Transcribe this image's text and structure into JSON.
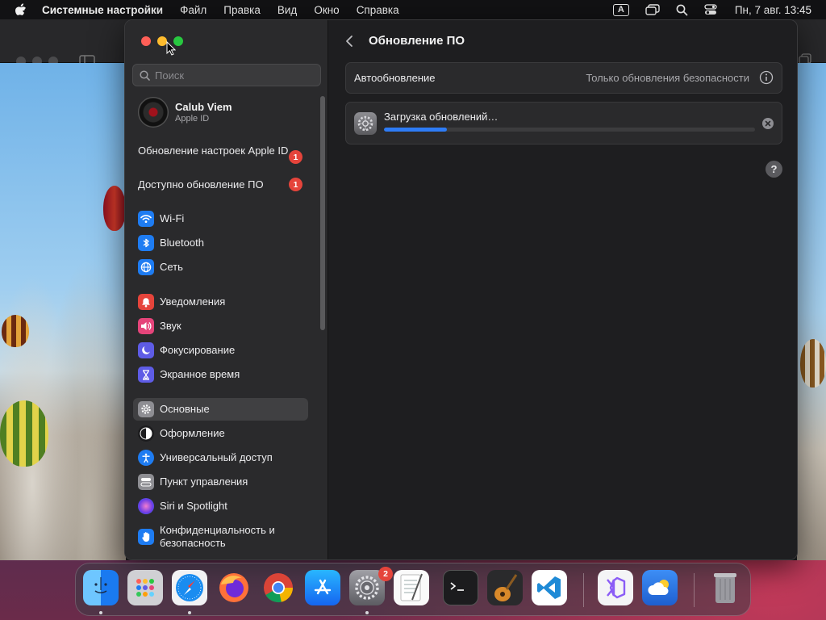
{
  "menubar": {
    "app_name": "Системные настройки",
    "items": [
      "Файл",
      "Правка",
      "Вид",
      "Окно",
      "Справка"
    ],
    "input_source": "A",
    "clock": "Пн, 7 авг.  13:45"
  },
  "sidebar": {
    "search_placeholder": "Поиск",
    "account": {
      "name": "Calub Viem",
      "subtitle": "Apple ID"
    },
    "notices": [
      {
        "label": "Обновление настроек Apple ID",
        "badge": "1"
      },
      {
        "label": "Доступно обновление ПО",
        "badge": "1"
      }
    ],
    "items": [
      {
        "label": "Wi-Fi",
        "icon": "wifi-icon",
        "color": "#1e7cf2"
      },
      {
        "label": "Bluetooth",
        "icon": "bluetooth-icon",
        "color": "#1e7cf2"
      },
      {
        "label": "Сеть",
        "icon": "globe-icon",
        "color": "#1e7cf2"
      },
      {
        "label": "Уведомления",
        "icon": "bell-icon",
        "color": "#e5443b"
      },
      {
        "label": "Звук",
        "icon": "speaker-icon",
        "color": "#e5447a"
      },
      {
        "label": "Фокусирование",
        "icon": "moon-icon",
        "color": "#5e5ce6"
      },
      {
        "label": "Экранное время",
        "icon": "hourglass-icon",
        "color": "#5e5ce6"
      },
      {
        "label": "Основные",
        "icon": "gear-icon",
        "color": "#8e8e93",
        "selected": true
      },
      {
        "label": "Оформление",
        "icon": "appearance-icon",
        "color": "#1c1c1e"
      },
      {
        "label": "Универсальный доступ",
        "icon": "accessibility-icon",
        "color": "#1e7cf2"
      },
      {
        "label": "Пункт управления",
        "icon": "control-center-icon",
        "color": "#8e8e93"
      },
      {
        "label": "Siri и Spotlight",
        "icon": "siri-icon",
        "color": "#c13fd6"
      },
      {
        "label": "Конфиденциальность и безопасность",
        "icon": "hand-icon",
        "color": "#1e7cf2"
      }
    ]
  },
  "main": {
    "title": "Обновление ПО",
    "auto_update": {
      "label": "Автообновление",
      "value": "Только обновления безопасности"
    },
    "download": {
      "label": "Загрузка обновлений…",
      "progress": 0.17
    },
    "help": "?"
  },
  "dock": {
    "apps": [
      "Finder",
      "Launchpad",
      "Safari",
      "Firefox",
      "Chrome",
      "App Store",
      "Системные настройки",
      "TextEdit",
      "Terminal",
      "GarageBand",
      "Visual Studio Code",
      "Visual Studio",
      "Weather",
      "Trash"
    ],
    "settings_badge": "2"
  },
  "colors": {
    "accent": "#2e7cf6",
    "badge": "#e5443b"
  }
}
